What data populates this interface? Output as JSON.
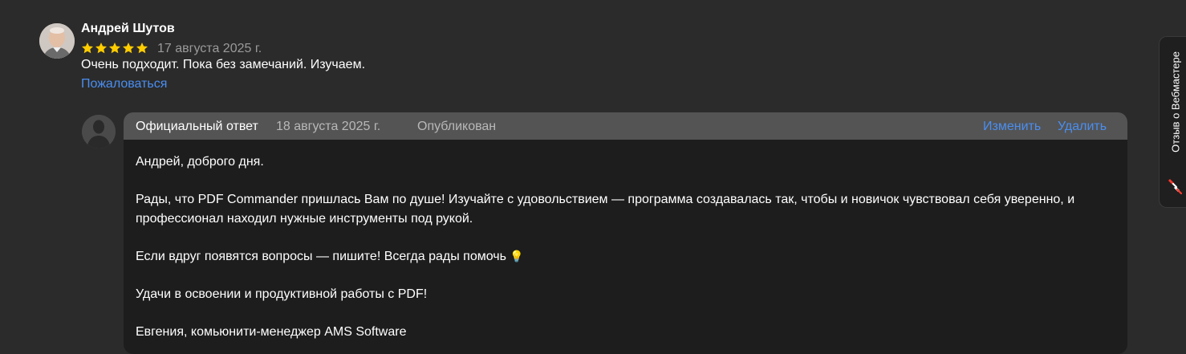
{
  "review": {
    "author": "Андрей Шутов",
    "rating": 5,
    "date": "17 августа 2025 г.",
    "text": "Очень подходит. Пока без замечаний. Изучаем.",
    "complain_label": "Пожаловаться"
  },
  "reply": {
    "title": "Официальный ответ",
    "date": "18 августа 2025 г.",
    "status": "Опубликован",
    "edit_label": "Изменить",
    "delete_label": "Удалить",
    "paragraphs": [
      "Андрей, доброго дня.",
      "Рады, что PDF Commander пришлась Вам по душе! Изучайте с удовольствием — программа создавалась так, чтобы и новичок чувствовал себя уверенно, и профессионал находил нужные инструменты под рукой.",
      "Если вдруг появятся вопросы — пишите! Всегда рады помочь",
      "Удачи в освоении и продуктивной работы с PDF!",
      "Евгения, комьюнити-менеджер AMS Software"
    ],
    "emoji": "💡"
  },
  "side_tab": {
    "label": "Отзыв о Вебмастере",
    "icon": "wrench-icon"
  },
  "colors": {
    "background": "#2b2b2b",
    "card": "#1d1d1d",
    "card_header": "#545454",
    "link": "#4a8ef0",
    "star": "#ffcc00",
    "muted": "#9a9a9a",
    "side_accent": "#ff3b30"
  }
}
